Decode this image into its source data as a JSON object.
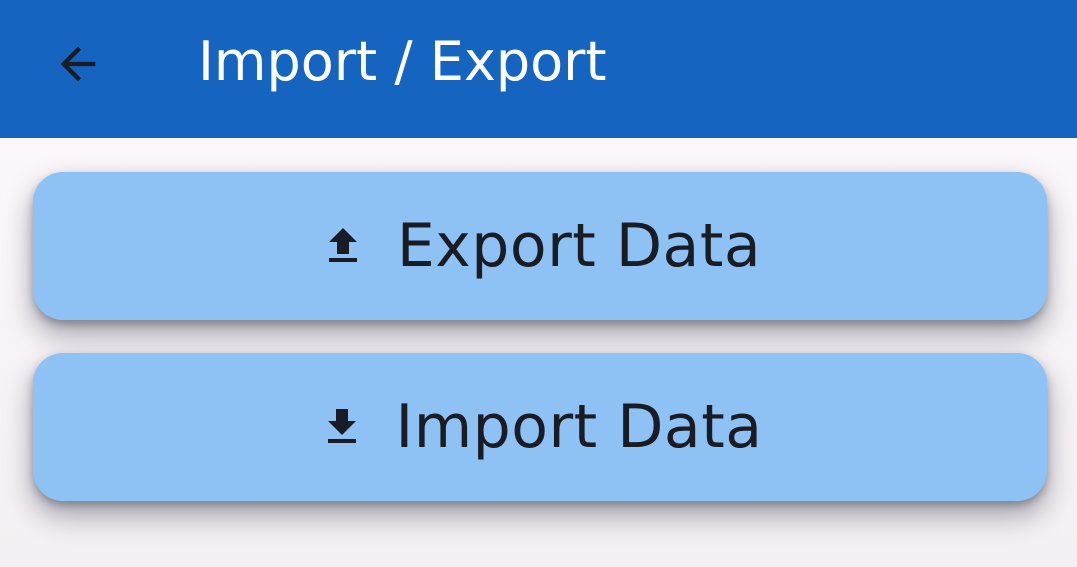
{
  "app_bar": {
    "back_icon": "arrow-back-icon",
    "title": "Import / Export",
    "background_color": "#1565c0"
  },
  "actions": {
    "export": {
      "label": "Export Data",
      "icon": "upload-icon"
    },
    "import": {
      "label": "Import Data",
      "icon": "download-icon"
    },
    "button_color": "#8ec1f4"
  }
}
